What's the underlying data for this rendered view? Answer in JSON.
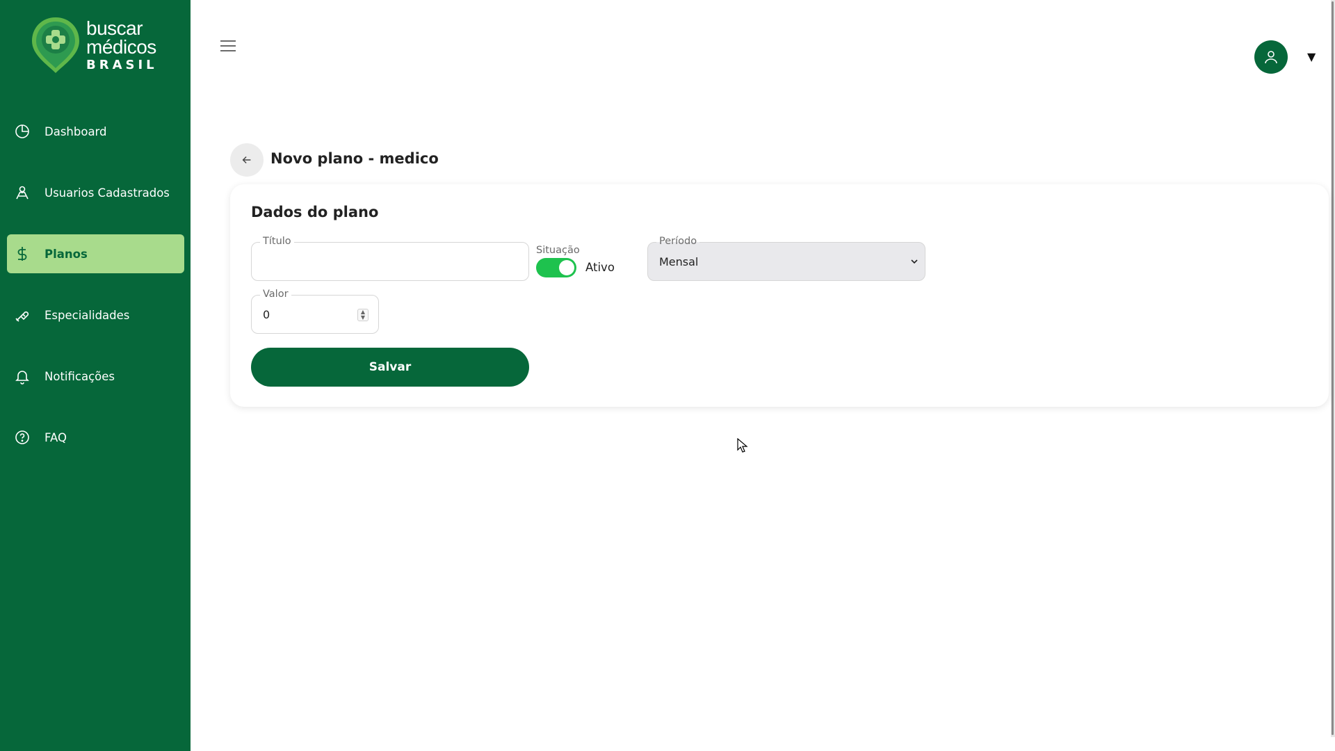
{
  "brand": {
    "line1": "buscar",
    "line2": "médicos",
    "line3": "BRASIL"
  },
  "colors": {
    "sidebar_bg": "#06673a",
    "active_item_bg": "#a8db8c",
    "toggle_on": "#1ec24e",
    "primary_button": "#06673a"
  },
  "sidebar": {
    "items": [
      {
        "label": "Dashboard",
        "icon": "pie-chart-icon",
        "active": false
      },
      {
        "label": "Usuarios Cadastrados",
        "icon": "users-icon",
        "active": false
      },
      {
        "label": "Planos",
        "icon": "dollar-icon",
        "active": true
      },
      {
        "label": "Especialidades",
        "icon": "pill-icon",
        "active": false
      },
      {
        "label": "Notificações",
        "icon": "bell-icon",
        "active": false
      },
      {
        "label": "FAQ",
        "icon": "help-circle-icon",
        "active": false
      }
    ]
  },
  "header": {
    "menu_icon": "hamburger-menu-icon",
    "user_icon": "user-icon",
    "caret": "▼"
  },
  "page": {
    "title": "Novo plano - medico",
    "back_icon": "arrow-left-icon"
  },
  "form": {
    "section_title": "Dados do plano",
    "titulo": {
      "label": "Título",
      "value": ""
    },
    "situacao": {
      "label": "Situação",
      "state_label": "Ativo",
      "checked": true
    },
    "periodo": {
      "label": "Período",
      "selected": "Mensal"
    },
    "valor": {
      "label": "Valor",
      "value": "0"
    },
    "save_label": "Salvar"
  }
}
